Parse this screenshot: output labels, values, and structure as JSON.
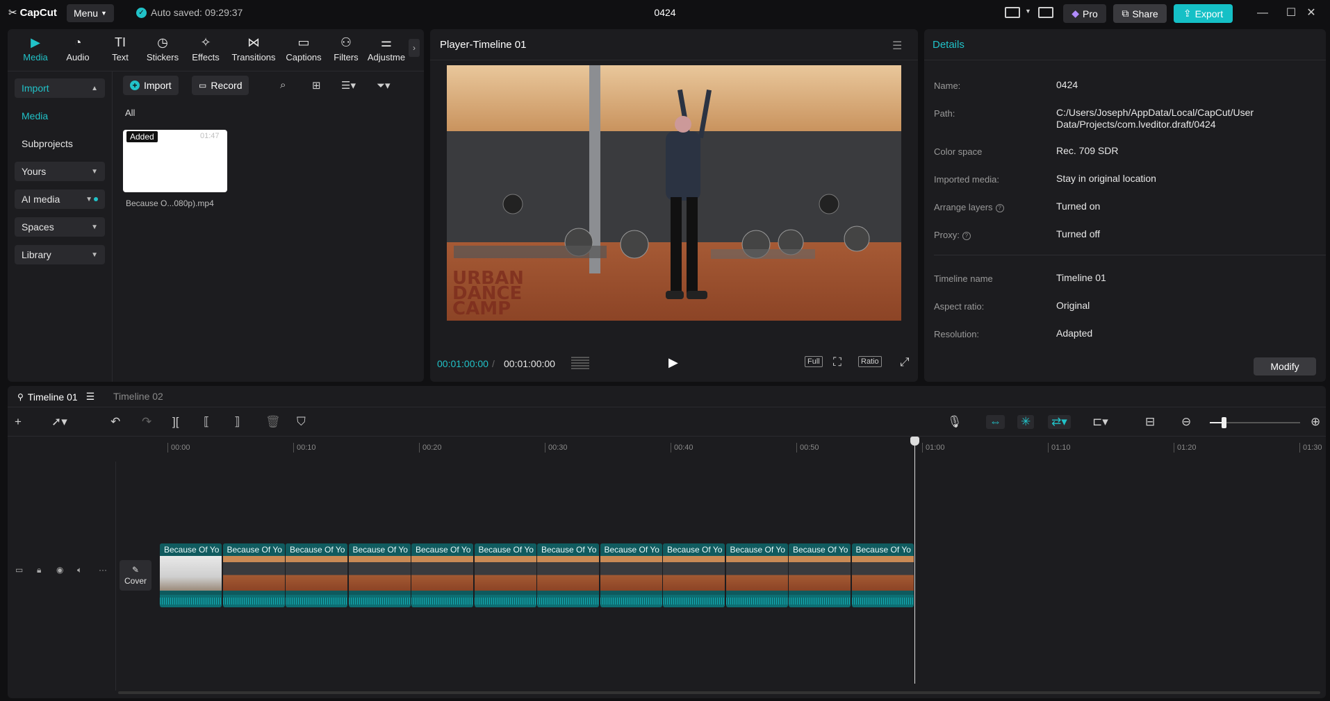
{
  "app": {
    "logo": "CapCut",
    "menu_label": "Menu",
    "autosave": "Auto saved: 09:29:37",
    "project_title": "0424"
  },
  "titlebar": {
    "pro_label": "Pro",
    "share_label": "Share",
    "export_label": "Export"
  },
  "media_tabs": [
    {
      "label": "Media",
      "icon": "media-icon"
    },
    {
      "label": "Audio",
      "icon": "audio-icon"
    },
    {
      "label": "Text",
      "icon": "text-icon"
    },
    {
      "label": "Stickers",
      "icon": "stickers-icon"
    },
    {
      "label": "Effects",
      "icon": "effects-icon"
    },
    {
      "label": "Transitions",
      "icon": "transitions-icon"
    },
    {
      "label": "Captions",
      "icon": "captions-icon"
    },
    {
      "label": "Filters",
      "icon": "filters-icon"
    },
    {
      "label": "Adjustme",
      "icon": "adjustment-icon"
    }
  ],
  "sidebar": {
    "items": [
      {
        "label": "Import"
      },
      {
        "label": "Media"
      },
      {
        "label": "Subprojects"
      },
      {
        "label": "Yours"
      },
      {
        "label": "AI media"
      },
      {
        "label": "Spaces"
      },
      {
        "label": "Library"
      }
    ]
  },
  "media": {
    "import_label": "Import",
    "record_label": "Record",
    "filter_all": "All",
    "item": {
      "badge": "Added",
      "duration": "01:47",
      "name": "Because O...080p).mp4"
    }
  },
  "player": {
    "title": "Player-Timeline 01",
    "current_time": "00:01:00:00",
    "total_time": "00:01:00:00",
    "full_label": "Full",
    "ratio_label": "Ratio",
    "watermark": [
      "URBAN",
      "DANCE",
      "CAMP"
    ]
  },
  "details": {
    "title": "Details",
    "rows": [
      {
        "key": "Name:",
        "value": "0424"
      },
      {
        "key": "Path:",
        "value": "C:/Users/Joseph/AppData/Local/CapCut/User Data/Projects/com.lveditor.draft/0424"
      },
      {
        "key": "Color space",
        "value": "Rec. 709 SDR"
      },
      {
        "key": "Imported media:",
        "value": "Stay in original location"
      },
      {
        "key": "Arrange layers",
        "value": "Turned on"
      },
      {
        "key": "Proxy:",
        "value": "Turned off"
      },
      {
        "key": "Timeline name",
        "value": "Timeline 01"
      },
      {
        "key": "Aspect ratio:",
        "value": "Original"
      },
      {
        "key": "Resolution:",
        "value": "Adapted"
      }
    ],
    "modify_label": "Modify"
  },
  "timeline": {
    "tabs": [
      "Timeline 01",
      "Timeline 02"
    ],
    "ruler": [
      "00:00",
      "00:10",
      "00:20",
      "00:30",
      "00:40",
      "00:50",
      "01:00",
      "01:10",
      "01:20",
      "01:30"
    ],
    "cover_label": "Cover",
    "clip_label": "Because Of Yo",
    "clip_count": 12,
    "zoom_fraction": 0.15
  },
  "colors": {
    "accent": "#21c2c8",
    "clip": "#105b5f"
  }
}
